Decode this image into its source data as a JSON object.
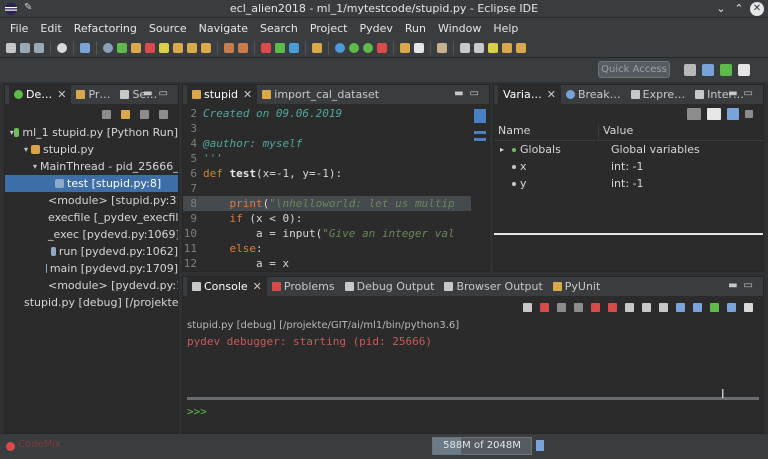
{
  "window": {
    "title": "ecl_alien2018 - ml_1/mytestcode/stupid.py - Eclipse IDE"
  },
  "menu": [
    "File",
    "Edit",
    "Refactoring",
    "Source",
    "Navigate",
    "Search",
    "Project",
    "Pydev",
    "Run",
    "Window",
    "Help"
  ],
  "quick_access": {
    "placeholder": "Quick Access"
  },
  "debug_panel": {
    "tabs": [
      "De…",
      "Pr…",
      "Se…"
    ],
    "tree": [
      {
        "label": "ml_1 stupid.py [Python Run]",
        "indent": 0,
        "arrow": "▾",
        "icon_color": "#6fbf5a"
      },
      {
        "label": "stupid.py",
        "indent": 1,
        "arrow": "▾",
        "icon_color": "#d9a34a"
      },
      {
        "label": "MainThread - pid_25666_id_",
        "indent": 2,
        "arrow": "▾",
        "icon_color": "#d9a34a"
      },
      {
        "label": "test [stupid.py:8]",
        "indent": 3,
        "arrow": "",
        "icon_color": "#8fa9c9",
        "selected": true
      },
      {
        "label": "<module> [stupid.py:31]",
        "indent": 3,
        "arrow": "",
        "icon_color": "#8fa9c9"
      },
      {
        "label": "execfile [_pydev_execfile.",
        "indent": 3,
        "arrow": "",
        "icon_color": "#8fa9c9"
      },
      {
        "label": "_exec [pydevd.py:1069]",
        "indent": 3,
        "arrow": "",
        "icon_color": "#8fa9c9"
      },
      {
        "label": "run [pydevd.py:1062]",
        "indent": 3,
        "arrow": "",
        "icon_color": "#8fa9c9"
      },
      {
        "label": "main [pydevd.py:1709]",
        "indent": 3,
        "arrow": "",
        "icon_color": "#8fa9c9"
      },
      {
        "label": "<module> [pydevd.py:17",
        "indent": 3,
        "arrow": "",
        "icon_color": "#8fa9c9"
      },
      {
        "label": "stupid.py [debug] [/projekte/C",
        "indent": 1,
        "arrow": "",
        "icon_color": "#9b7bd0"
      }
    ]
  },
  "editor": {
    "tabs": [
      "stupid",
      "import_cal_dataset"
    ],
    "lines": [
      {
        "n": "2",
        "parts": [
          {
            "t": "Created on 09.06.2019",
            "c": "comment"
          }
        ]
      },
      {
        "n": "3",
        "parts": [
          {
            "t": "",
            "c": "plain"
          }
        ]
      },
      {
        "n": "4",
        "parts": [
          {
            "t": "@author: myself",
            "c": "comment"
          }
        ]
      },
      {
        "n": "5",
        "parts": [
          {
            "t": "'''",
            "c": "comment"
          }
        ]
      },
      {
        "n": "6",
        "parts": [
          {
            "t": "def ",
            "c": "kw"
          },
          {
            "t": "test",
            "c": "fn"
          },
          {
            "t": "(x=-1, y=-1):",
            "c": "plain"
          }
        ]
      },
      {
        "n": "7",
        "parts": [
          {
            "t": "",
            "c": "plain"
          }
        ]
      },
      {
        "n": "8",
        "parts": [
          {
            "t": "    ",
            "c": "plain"
          },
          {
            "t": "print",
            "c": "kw"
          },
          {
            "t": "(",
            "c": "plain"
          },
          {
            "t": "\"\\nhelloworld: let us multip",
            "c": "str"
          }
        ],
        "highlight": true
      },
      {
        "n": "9",
        "parts": [
          {
            "t": "    ",
            "c": "plain"
          },
          {
            "t": "if",
            "c": "kw"
          },
          {
            "t": " (x < 0):",
            "c": "plain"
          }
        ]
      },
      {
        "n": "10",
        "parts": [
          {
            "t": "        a = input(",
            "c": "plain"
          },
          {
            "t": "\"Give an integer val",
            "c": "str"
          }
        ]
      },
      {
        "n": "11",
        "parts": [
          {
            "t": "    ",
            "c": "plain"
          },
          {
            "t": "else",
            "c": "kw"
          },
          {
            "t": ":",
            "c": "plain"
          }
        ]
      },
      {
        "n": "12",
        "parts": [
          {
            "t": "        a = x",
            "c": "plain"
          }
        ]
      }
    ]
  },
  "variables_panel": {
    "tabs": [
      "Varia…",
      "Break…",
      "Expre…",
      "Inter…"
    ],
    "col_name": "Name",
    "col_value": "Value",
    "rows": [
      {
        "name": "Globals",
        "value": "Global variables",
        "arrow": "▸",
        "dot": "#6fbf5a"
      },
      {
        "name": "x",
        "value": "int: -1",
        "arrow": "",
        "dot": "#c8c8c8"
      },
      {
        "name": "y",
        "value": "int: -1",
        "arrow": "",
        "dot": "#c8c8c8"
      }
    ]
  },
  "console_panel": {
    "tabs": [
      "Console",
      "Problems",
      "Debug Output",
      "Browser Output",
      "PyUnit"
    ],
    "launch": "stupid.py [debug] [/projekte/GIT/ai/ml1/bin/python3.6]",
    "output": "pydev debugger: starting (pid: 25666)",
    "prompt": ">>>"
  },
  "status": {
    "left": "CodeMix",
    "memory": "588M of 2048M",
    "memory_fraction": 0.287
  }
}
